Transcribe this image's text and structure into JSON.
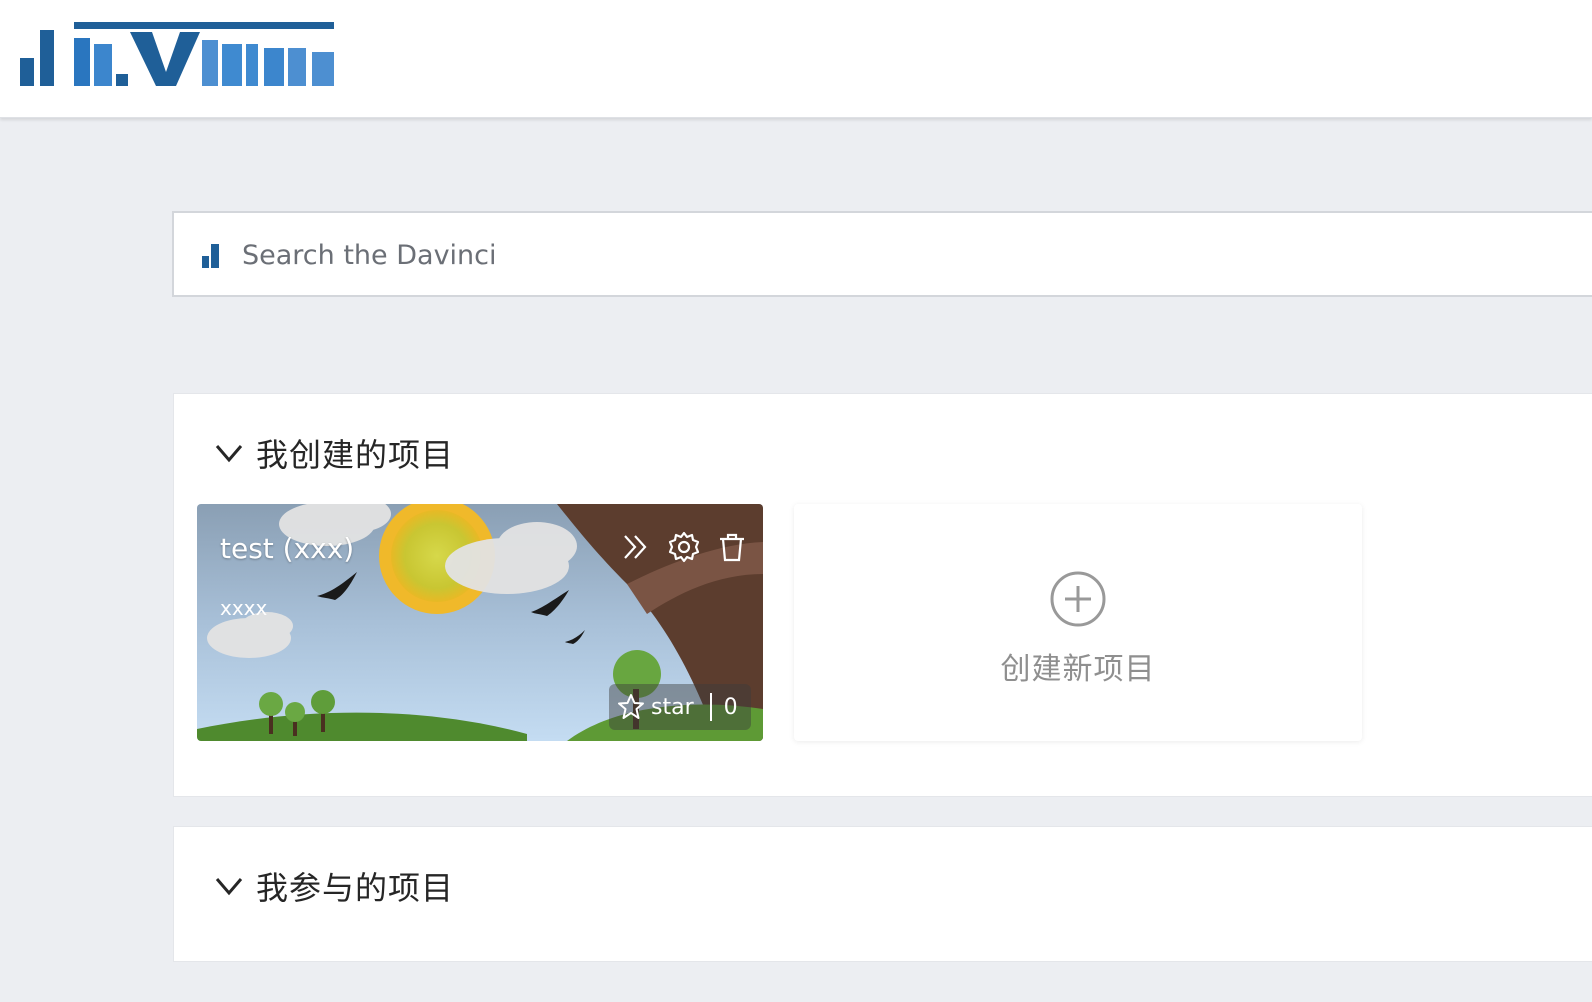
{
  "header": {
    "logo_name": "davinci-logo"
  },
  "search": {
    "placeholder": "Search the Davinci"
  },
  "sections": [
    {
      "title": "我创建的项目",
      "expanded": true,
      "projects": [
        {
          "name": "test (xxx)",
          "description": "xxxx",
          "star_label": "star",
          "star_count": "0",
          "actions": [
            "double-chevron-right-icon",
            "gear-icon",
            "trash-icon"
          ]
        }
      ],
      "create_label": "创建新项目"
    },
    {
      "title": "我参与的项目",
      "expanded": true
    }
  ],
  "colors": {
    "brand_blue": "#1f6aab",
    "brand_blue_light": "#4d8fd1",
    "page_bg": "#eceef2"
  }
}
